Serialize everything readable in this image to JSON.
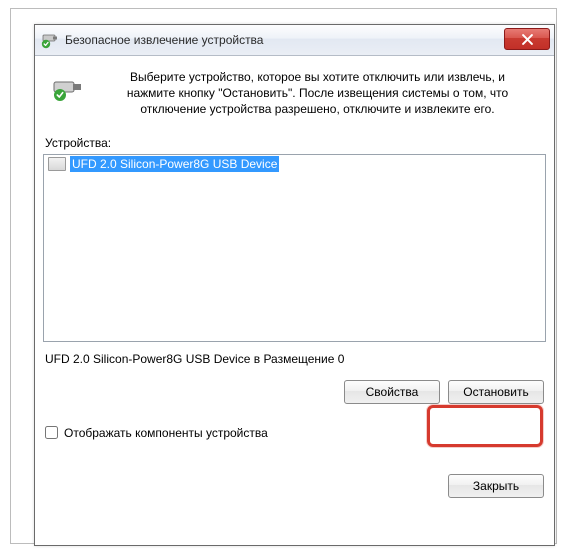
{
  "titlebar": {
    "title": "Безопасное извлечение устройства"
  },
  "instruction": {
    "text": "Выберите устройство, которое вы хотите отключить или извлечь, и нажмите кнопку \"Остановить\". После извещения системы о том, что отключение устройства разрешено, отключите и извлеките его."
  },
  "devices": {
    "label": "Устройства:",
    "items": [
      {
        "name": "UFD 2.0 Silicon-Power8G USB Device",
        "selected": true
      }
    ],
    "status": "UFD 2.0 Silicon-Power8G USB Device в Размещение 0"
  },
  "buttons": {
    "properties": "Свойства",
    "stop": "Остановить",
    "close": "Закрыть"
  },
  "checkbox": {
    "show_components": "Отображать компоненты устройства"
  },
  "icons": {
    "title_icon": "safely-remove-hardware-icon",
    "close": "close-icon",
    "device": "drive-icon"
  }
}
